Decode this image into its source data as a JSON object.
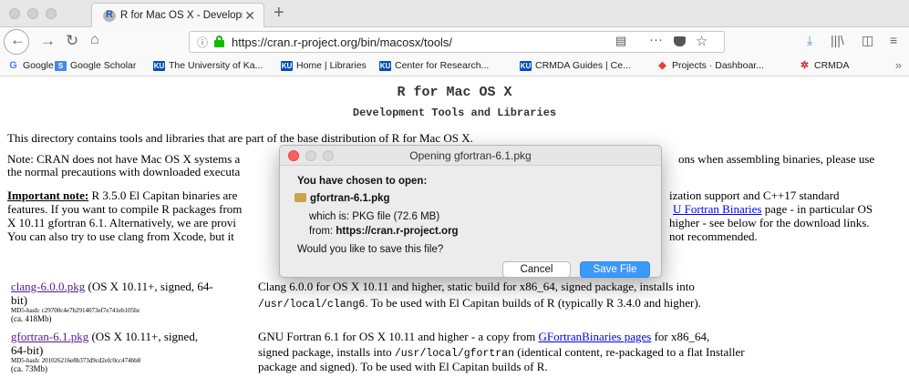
{
  "tab": {
    "title": "R for Mac OS X - Development"
  },
  "url": {
    "text": "https://cran.r-project.org/bin/macosx/tools/"
  },
  "bookmarks": [
    "Google",
    "Google Scholar",
    "The University of Ka...",
    "Home | Libraries",
    "Center for Research...",
    "CRMDA Guides | Ce...",
    "Projects · Dashboar...",
    "CRMDA"
  ],
  "page": {
    "title": "R for Mac OS X",
    "subtitle": "Development Tools and Libraries",
    "intro": "This directory contains tools and libraries that are part of the base distribution of R for Mac OS X.",
    "note_left_1": "Note: CRAN does not have Mac OS X systems a",
    "note_left_2": "the normal precautions with downloaded executa",
    "note_right": "ons when assembling binaries, please use",
    "important_label": "Important note:",
    "imp_l1": " R 3.5.0 El Capitan binaries are",
    "imp_l2": "features. If you want to compile R packages from",
    "imp_l3": "X 10.11 gfortran 6.1. Alternatively, we are provi",
    "imp_l4": "You can also try to use clang from Xcode, but it",
    "imp_r1": "ization support and C++17 standard",
    "imp_r2_link": "U Fortran Binaries",
    "imp_r2_after": " page - in particular OS",
    "imp_r3": "higher - see below for the download links.",
    "imp_r4": "not recommended.",
    "clang_link": "clang-6.0.0.pkg",
    "clang_after": " (OS X 10.11+, signed, 64-",
    "clang_bit": "bit)",
    "clang_md5": "MD5-hash: c29700c4e7b2914073ef7e741eb105bc",
    "clang_size": "(ca. 418Mb)",
    "clang_desc_1": "Clang 6.0.0 for OS X 10.11 and higher, static build for x86_64, signed package, installs into",
    "clang_desc_2_code": "/usr/local/clang6",
    "clang_desc_2_rest": ". To be used with El Capitan builds of R (typically R 3.4.0 and higher).",
    "gf_link": "gfortran-6.1.pkg",
    "gf_after": " (OS X 10.11+, signed,",
    "gf_bit": "64-bit)",
    "gf_md5": "MD5-hash: 201026216e8b373d9cd2efc0cc474bb8",
    "gf_size": "(ca. 73Mb)",
    "gf_desc_1_a": "GNU Fortran 6.1 for OS X 10.11 and higher - a copy from ",
    "gf_desc_1_link": "GFortranBinaries pages",
    "gf_desc_1_b": " for x86_64,",
    "gf_desc_2_a": "signed package, installs into ",
    "gf_desc_2_code": "/usr/local/gfortran",
    "gf_desc_2_b": " (identical content, re-packaged to a flat Installer",
    "gf_desc_3": "package and signed). To be used with El Capitan builds of R."
  },
  "dialog": {
    "title": "Opening gfortran-6.1.pkg",
    "heading": "You have chosen to open:",
    "filename": "gfortran-6.1.pkg",
    "which_is": "which is: PKG file (72.6 MB)",
    "from_label": "from: ",
    "from_value": "https://cran.r-project.org",
    "question": "Would you like to save this file?",
    "cancel": "Cancel",
    "save": "Save File"
  }
}
